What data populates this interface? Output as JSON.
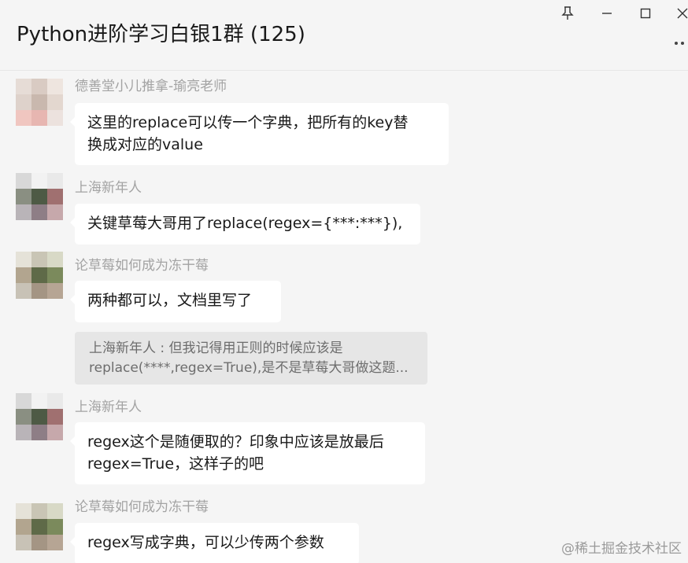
{
  "header": {
    "title": "Python进阶学习白银1群 (125)",
    "controls": {
      "pin_icon": "pin-icon",
      "minimize_icon": "minimize-icon",
      "maximize_icon": "maximize-icon",
      "close_icon": "close-icon",
      "more_icon": "more-dots-icon"
    }
  },
  "messages": [
    {
      "sender": "德善堂小儿推拿-瑜亮老师",
      "lines": [
        "这里的replace可以传一个字典，把所有的key替",
        "换成对应的value"
      ]
    },
    {
      "sender": "上海新年人",
      "lines": [
        "关键草莓大哥用了replace(regex={***:***}),"
      ]
    },
    {
      "sender": "论草莓如何成为冻干莓",
      "lines": [
        "两种都可以，文档里写了"
      ]
    },
    {
      "sender": "上海新年人",
      "lines": [
        "regex这个是随便取的？印象中应该是放最后",
        "regex=True，这样子的吧"
      ]
    },
    {
      "sender": "论草莓如何成为冻干莓",
      "lines": [
        "regex写成字典，可以少传两个参数"
      ]
    }
  ],
  "quote": {
    "line1": "上海新年人 : 但我记得用正则的时候应该是",
    "line2": "replace(****,regex=True),是不是草莓大哥做这题..."
  },
  "watermark": "@稀土掘金技术社区",
  "colors": {
    "background": "#f5f5f5",
    "bubble": "#ffffff",
    "quote_bg": "#e6e6e6",
    "sender_text": "#a3a3a3"
  }
}
